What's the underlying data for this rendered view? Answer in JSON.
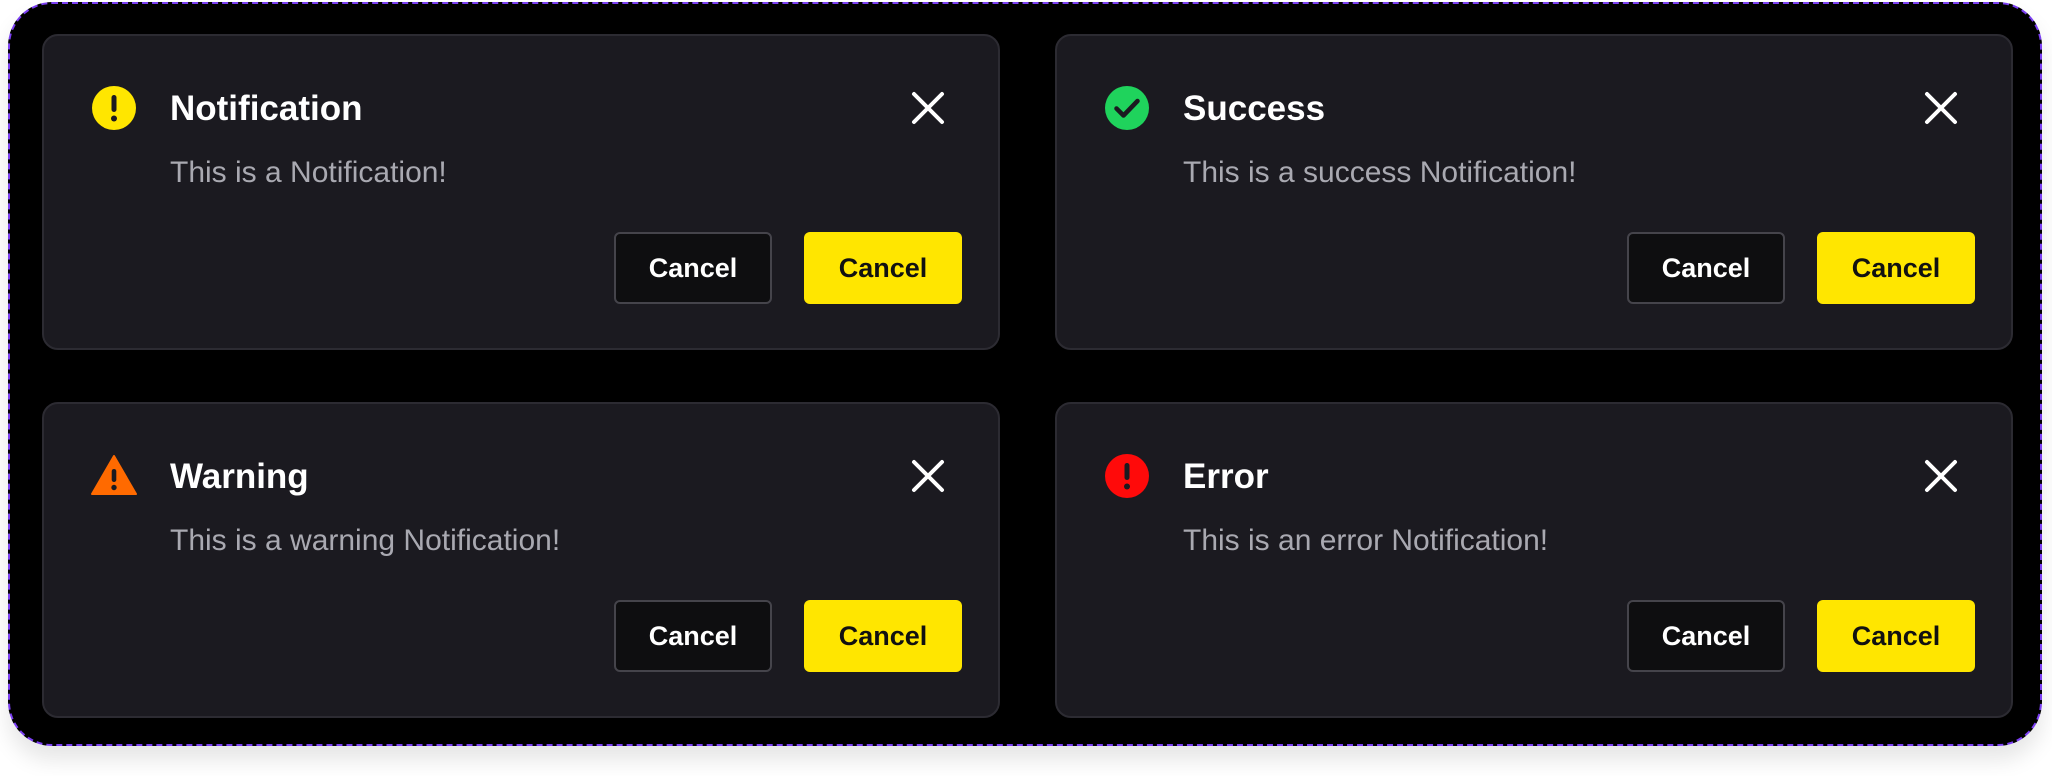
{
  "colors": {
    "frame_bg": "#000000",
    "card_bg": "#1b1a20",
    "accent_yellow": "#ffe600",
    "success_green": "#1fd35c",
    "warning_orange": "#ff6a00",
    "error_red": "#ff0a0a"
  },
  "notifications": [
    {
      "type": "notification",
      "icon": "exclamation-circle-icon",
      "icon_color": "#ffe600",
      "title": "Notification",
      "message": "This is a Notification!",
      "secondary_label": "Cancel",
      "primary_label": "Cancel"
    },
    {
      "type": "success",
      "icon": "check-circle-icon",
      "icon_color": "#1fd35c",
      "title": "Success",
      "message": "This is a success Notification!",
      "secondary_label": "Cancel",
      "primary_label": "Cancel"
    },
    {
      "type": "warning",
      "icon": "warning-triangle-icon",
      "icon_color": "#ff6a00",
      "title": "Warning",
      "message": "This is a warning Notification!",
      "secondary_label": "Cancel",
      "primary_label": "Cancel"
    },
    {
      "type": "error",
      "icon": "error-circle-icon",
      "icon_color": "#ff0a0a",
      "title": "Error",
      "message": "This is an error Notification!",
      "secondary_label": "Cancel",
      "primary_label": "Cancel"
    }
  ]
}
